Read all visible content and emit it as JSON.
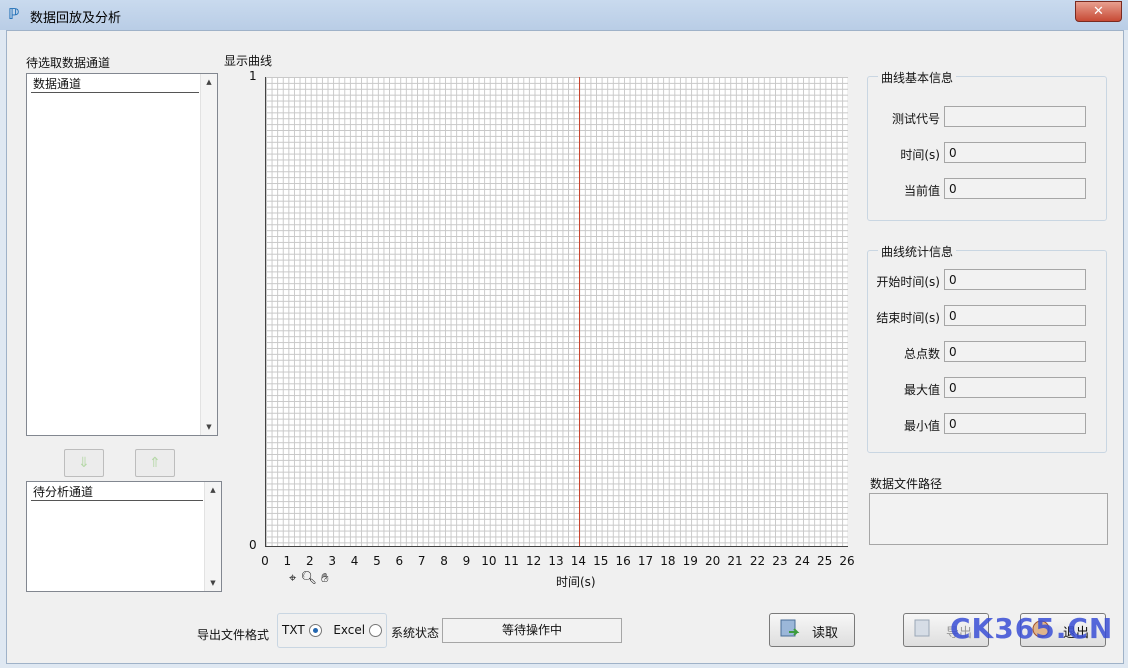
{
  "window": {
    "title": "数据回放及分析",
    "close_glyph": "✕"
  },
  "left": {
    "source_title": "待选取数据通道",
    "source_header": "数据通道",
    "move_down_glyph": "⇓",
    "move_up_glyph": "⇑",
    "target_header": "待分析通道"
  },
  "plot": {
    "title": "显示曲线",
    "y_top": "1",
    "y_bottom": "0",
    "xlabel": "时间(s)",
    "xticks": [
      "0",
      "1",
      "2",
      "3",
      "4",
      "5",
      "6",
      "7",
      "8",
      "9",
      "10",
      "11",
      "12",
      "13",
      "14",
      "15",
      "16",
      "17",
      "18",
      "19",
      "20",
      "21",
      "22",
      "23",
      "24",
      "25",
      "26"
    ]
  },
  "basic_info": {
    "title": "曲线基本信息",
    "rows": [
      {
        "label": "测试代号",
        "value": ""
      },
      {
        "label": "时间(s)",
        "value": "0"
      },
      {
        "label": "当前值",
        "value": "0"
      }
    ]
  },
  "stats_info": {
    "title": "曲线统计信息",
    "rows": [
      {
        "label": "开始时间(s)",
        "value": "0"
      },
      {
        "label": "结束时间(s)",
        "value": "0"
      },
      {
        "label": "总点数",
        "value": "0"
      },
      {
        "label": "最大值",
        "value": "0"
      },
      {
        "label": "最小值",
        "value": "0"
      }
    ]
  },
  "file_path": {
    "label": "数据文件路径",
    "value": ""
  },
  "bottom": {
    "export_label": "导出文件格式",
    "opt_txt": "TXT",
    "opt_excel": "Excel",
    "status_label": "系统状态",
    "status_value": "等待操作中",
    "read_button": "读取",
    "export_button": "导出",
    "exit_button": "退出"
  },
  "watermark": "CK365.CN",
  "colors": {
    "cursor": "#c8442e",
    "accent": "#2467b0"
  },
  "chart_data": {
    "type": "line",
    "title": "显示曲线",
    "xlabel": "时间(s)",
    "ylabel": "",
    "xlim": [
      0,
      26
    ],
    "ylim": [
      0,
      1
    ],
    "grid": true,
    "series": [],
    "cursor_x": 14
  }
}
